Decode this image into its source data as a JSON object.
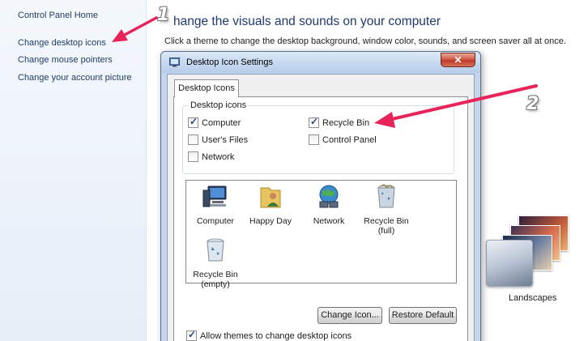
{
  "sidebar": {
    "items": [
      {
        "label": "Control Panel Home"
      },
      {
        "label": "Change desktop icons"
      },
      {
        "label": "Change mouse pointers"
      },
      {
        "label": "Change your account picture"
      }
    ]
  },
  "main": {
    "title": "hange the visuals and sounds on your computer",
    "description": "Click a theme to change the desktop background, window color, sounds, and screen saver all at once.",
    "theme_label": "Landscapes"
  },
  "dialog": {
    "title": "Desktop Icon Settings",
    "close_label": "✕",
    "tab_label": "Desktop Icons",
    "group_label": "Desktop icons",
    "checkboxes": [
      {
        "label": "Computer",
        "checked": true
      },
      {
        "label": "Recycle Bin",
        "checked": true
      },
      {
        "label": "User's Files",
        "checked": false
      },
      {
        "label": "Control Panel",
        "checked": false
      },
      {
        "label": "Network",
        "checked": false
      }
    ],
    "icons": [
      {
        "label": "Computer",
        "sub": "",
        "icon": "computer-icon"
      },
      {
        "label": "Happy Day",
        "sub": "",
        "icon": "user-folder-icon"
      },
      {
        "label": "Network",
        "sub": "",
        "icon": "network-globe-icon"
      },
      {
        "label": "Recycle Bin",
        "sub": "(full)",
        "icon": "recycle-bin-full-icon"
      },
      {
        "label": "Recycle Bin",
        "sub": "(empty)",
        "icon": "recycle-bin-empty-icon"
      }
    ],
    "change_icon_label": "Change Icon...",
    "restore_default_label": "Restore Default",
    "allow_themes_label": "Allow themes to change desktop icons",
    "allow_themes_checked": true
  },
  "annotations": {
    "callout_1": "1",
    "callout_2": "2",
    "arrow_color": "#e8235a"
  }
}
